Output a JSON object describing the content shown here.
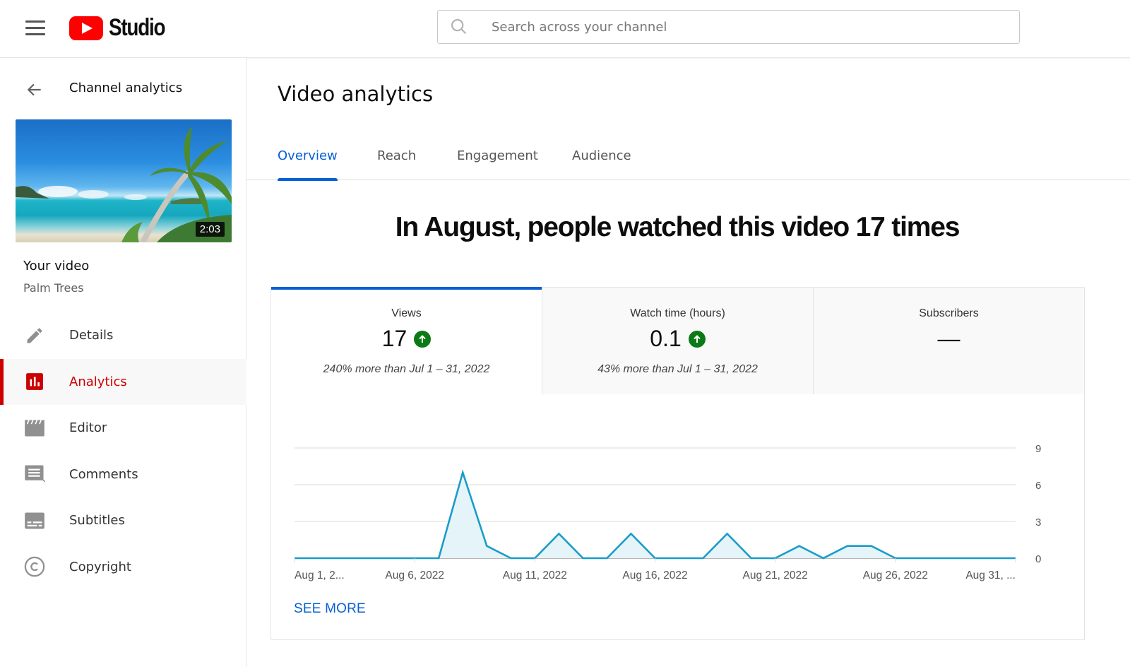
{
  "header": {
    "logo_text": "Studio",
    "search_placeholder": "Search across your channel",
    "search_value": ""
  },
  "sidebar": {
    "back_label": "Channel analytics",
    "video": {
      "duration": "2:03",
      "title": "Your video",
      "name": "Palm Trees"
    },
    "items": [
      {
        "label": "Details",
        "icon": "pencil-icon",
        "active": false
      },
      {
        "label": "Analytics",
        "icon": "analytics-icon",
        "active": true
      },
      {
        "label": "Editor",
        "icon": "clapperboard-icon",
        "active": false
      },
      {
        "label": "Comments",
        "icon": "comment-icon",
        "active": false
      },
      {
        "label": "Subtitles",
        "icon": "subtitles-icon",
        "active": false
      },
      {
        "label": "Copyright",
        "icon": "copyright-icon",
        "active": false
      }
    ]
  },
  "main": {
    "title": "Video analytics",
    "tabs": [
      {
        "label": "Overview",
        "active": true
      },
      {
        "label": "Reach",
        "active": false
      },
      {
        "label": "Engagement",
        "active": false
      },
      {
        "label": "Audience",
        "active": false
      }
    ],
    "headline": "In August, people watched this video 17 times",
    "metrics": [
      {
        "label": "Views",
        "value": "17",
        "trend": "up",
        "comparison": "240% more than Jul 1 – 31, 2022",
        "active": true
      },
      {
        "label": "Watch time (hours)",
        "value": "0.1",
        "trend": "up",
        "comparison": "43% more than Jul 1 – 31, 2022",
        "active": false
      },
      {
        "label": "Subscribers",
        "value": "—",
        "trend": null,
        "comparison": "",
        "active": false
      }
    ],
    "see_more_label": "SEE MORE"
  },
  "colors": {
    "accent_blue": "#065fd4",
    "brand_red": "#ff0000",
    "active_red": "#cc0000",
    "trend_green": "#0b7a16",
    "line": "#1a9cc9",
    "area_fill": "#e5f4f8"
  },
  "chart_data": {
    "type": "area",
    "title": "",
    "xlabel": "",
    "ylabel": "Views",
    "x": [
      "Aug 1",
      "Aug 2",
      "Aug 3",
      "Aug 4",
      "Aug 5",
      "Aug 6",
      "Aug 7",
      "Aug 8",
      "Aug 9",
      "Aug 10",
      "Aug 11",
      "Aug 12",
      "Aug 13",
      "Aug 14",
      "Aug 15",
      "Aug 16",
      "Aug 17",
      "Aug 18",
      "Aug 19",
      "Aug 20",
      "Aug 21",
      "Aug 22",
      "Aug 23",
      "Aug 24",
      "Aug 25",
      "Aug 26",
      "Aug 27",
      "Aug 28",
      "Aug 29",
      "Aug 30",
      "Aug 31"
    ],
    "series": [
      {
        "name": "Views",
        "values": [
          0,
          0,
          0,
          0,
          0,
          0,
          0,
          7,
          1,
          0,
          0,
          2,
          0,
          0,
          2,
          0,
          0,
          0,
          2,
          0,
          0,
          1,
          0,
          1,
          1,
          0,
          0,
          0,
          0,
          0,
          0
        ]
      }
    ],
    "x_tick_labels": [
      {
        "index": 0,
        "label": "Aug 1, 2..."
      },
      {
        "index": 5,
        "label": "Aug 6, 2022"
      },
      {
        "index": 10,
        "label": "Aug 11, 2022"
      },
      {
        "index": 15,
        "label": "Aug 16, 2022"
      },
      {
        "index": 20,
        "label": "Aug 21, 2022"
      },
      {
        "index": 25,
        "label": "Aug 26, 2022"
      },
      {
        "index": 30,
        "label": "Aug 31, ..."
      }
    ],
    "y_ticks": [
      0,
      3,
      6,
      9
    ],
    "ylim": [
      0,
      9
    ],
    "y_axis_side": "right",
    "grid": true
  }
}
